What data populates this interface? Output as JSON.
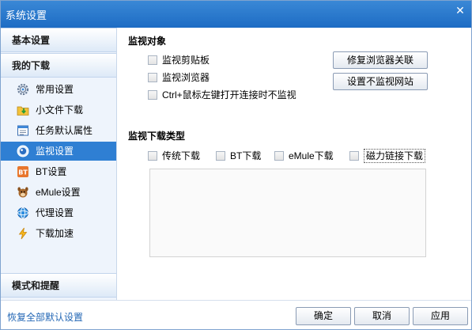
{
  "window": {
    "title": "系统设置"
  },
  "sidebar": {
    "sections": {
      "basic": "基本设置",
      "download": "我的下载",
      "mode": "模式和提醒"
    },
    "items": [
      {
        "label": "常用设置",
        "icon": "gear-icon"
      },
      {
        "label": "小文件下载",
        "icon": "small-file-download-icon"
      },
      {
        "label": "任务默认属性",
        "icon": "task-properties-icon"
      },
      {
        "label": "监视设置",
        "icon": "monitor-icon"
      },
      {
        "label": "BT设置",
        "icon": "bt-icon"
      },
      {
        "label": "eMule设置",
        "icon": "emule-icon"
      },
      {
        "label": "代理设置",
        "icon": "proxy-icon"
      },
      {
        "label": "下载加速",
        "icon": "lightning-icon"
      }
    ]
  },
  "monitor_target": {
    "title": "监视对象",
    "options": [
      "监视剪贴板",
      "监视浏览器",
      "Ctrl+鼠标左键打开连接时不监视"
    ],
    "repair_button": "修复浏览器关联",
    "no_monitor_sites_button": "设置不监视网站"
  },
  "monitor_type": {
    "title": "监视下载类型",
    "options": [
      "传统下载",
      "BT下载",
      "eMule下载",
      "磁力链接下载"
    ]
  },
  "footer": {
    "restore_link": "恢复全部默认设置",
    "ok": "确定",
    "cancel": "取消",
    "apply": "应用"
  },
  "colors": {
    "accent": "#2f7fd3",
    "titlebar": "#1d6cc4",
    "link": "#2367b5"
  }
}
